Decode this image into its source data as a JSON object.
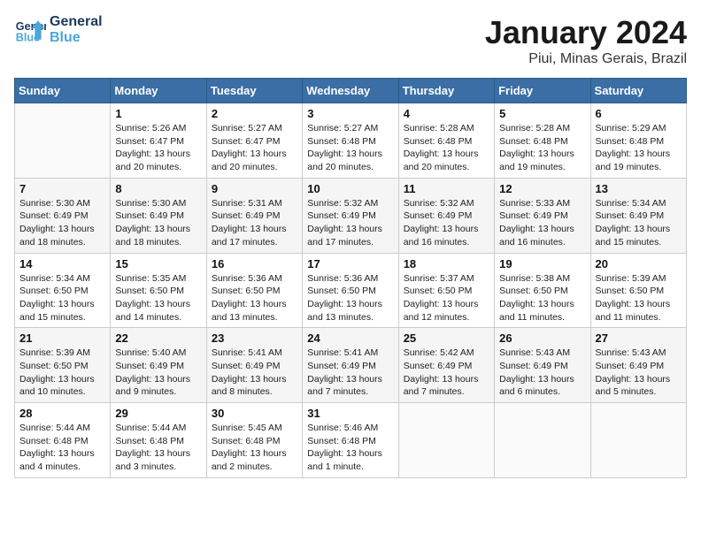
{
  "header": {
    "logo_line1": "General",
    "logo_line2": "Blue",
    "title": "January 2024",
    "subtitle": "Piui, Minas Gerais, Brazil"
  },
  "weekdays": [
    "Sunday",
    "Monday",
    "Tuesday",
    "Wednesday",
    "Thursday",
    "Friday",
    "Saturday"
  ],
  "weeks": [
    [
      {
        "day": "",
        "info": ""
      },
      {
        "day": "1",
        "info": "Sunrise: 5:26 AM\nSunset: 6:47 PM\nDaylight: 13 hours\nand 20 minutes."
      },
      {
        "day": "2",
        "info": "Sunrise: 5:27 AM\nSunset: 6:47 PM\nDaylight: 13 hours\nand 20 minutes."
      },
      {
        "day": "3",
        "info": "Sunrise: 5:27 AM\nSunset: 6:48 PM\nDaylight: 13 hours\nand 20 minutes."
      },
      {
        "day": "4",
        "info": "Sunrise: 5:28 AM\nSunset: 6:48 PM\nDaylight: 13 hours\nand 20 minutes."
      },
      {
        "day": "5",
        "info": "Sunrise: 5:28 AM\nSunset: 6:48 PM\nDaylight: 13 hours\nand 19 minutes."
      },
      {
        "day": "6",
        "info": "Sunrise: 5:29 AM\nSunset: 6:48 PM\nDaylight: 13 hours\nand 19 minutes."
      }
    ],
    [
      {
        "day": "7",
        "info": "Sunrise: 5:30 AM\nSunset: 6:49 PM\nDaylight: 13 hours\nand 18 minutes."
      },
      {
        "day": "8",
        "info": "Sunrise: 5:30 AM\nSunset: 6:49 PM\nDaylight: 13 hours\nand 18 minutes."
      },
      {
        "day": "9",
        "info": "Sunrise: 5:31 AM\nSunset: 6:49 PM\nDaylight: 13 hours\nand 17 minutes."
      },
      {
        "day": "10",
        "info": "Sunrise: 5:32 AM\nSunset: 6:49 PM\nDaylight: 13 hours\nand 17 minutes."
      },
      {
        "day": "11",
        "info": "Sunrise: 5:32 AM\nSunset: 6:49 PM\nDaylight: 13 hours\nand 16 minutes."
      },
      {
        "day": "12",
        "info": "Sunrise: 5:33 AM\nSunset: 6:49 PM\nDaylight: 13 hours\nand 16 minutes."
      },
      {
        "day": "13",
        "info": "Sunrise: 5:34 AM\nSunset: 6:49 PM\nDaylight: 13 hours\nand 15 minutes."
      }
    ],
    [
      {
        "day": "14",
        "info": "Sunrise: 5:34 AM\nSunset: 6:50 PM\nDaylight: 13 hours\nand 15 minutes."
      },
      {
        "day": "15",
        "info": "Sunrise: 5:35 AM\nSunset: 6:50 PM\nDaylight: 13 hours\nand 14 minutes."
      },
      {
        "day": "16",
        "info": "Sunrise: 5:36 AM\nSunset: 6:50 PM\nDaylight: 13 hours\nand 13 minutes."
      },
      {
        "day": "17",
        "info": "Sunrise: 5:36 AM\nSunset: 6:50 PM\nDaylight: 13 hours\nand 13 minutes."
      },
      {
        "day": "18",
        "info": "Sunrise: 5:37 AM\nSunset: 6:50 PM\nDaylight: 13 hours\nand 12 minutes."
      },
      {
        "day": "19",
        "info": "Sunrise: 5:38 AM\nSunset: 6:50 PM\nDaylight: 13 hours\nand 11 minutes."
      },
      {
        "day": "20",
        "info": "Sunrise: 5:39 AM\nSunset: 6:50 PM\nDaylight: 13 hours\nand 11 minutes."
      }
    ],
    [
      {
        "day": "21",
        "info": "Sunrise: 5:39 AM\nSunset: 6:50 PM\nDaylight: 13 hours\nand 10 minutes."
      },
      {
        "day": "22",
        "info": "Sunrise: 5:40 AM\nSunset: 6:49 PM\nDaylight: 13 hours\nand 9 minutes."
      },
      {
        "day": "23",
        "info": "Sunrise: 5:41 AM\nSunset: 6:49 PM\nDaylight: 13 hours\nand 8 minutes."
      },
      {
        "day": "24",
        "info": "Sunrise: 5:41 AM\nSunset: 6:49 PM\nDaylight: 13 hours\nand 7 minutes."
      },
      {
        "day": "25",
        "info": "Sunrise: 5:42 AM\nSunset: 6:49 PM\nDaylight: 13 hours\nand 7 minutes."
      },
      {
        "day": "26",
        "info": "Sunrise: 5:43 AM\nSunset: 6:49 PM\nDaylight: 13 hours\nand 6 minutes."
      },
      {
        "day": "27",
        "info": "Sunrise: 5:43 AM\nSunset: 6:49 PM\nDaylight: 13 hours\nand 5 minutes."
      }
    ],
    [
      {
        "day": "28",
        "info": "Sunrise: 5:44 AM\nSunset: 6:48 PM\nDaylight: 13 hours\nand 4 minutes."
      },
      {
        "day": "29",
        "info": "Sunrise: 5:44 AM\nSunset: 6:48 PM\nDaylight: 13 hours\nand 3 minutes."
      },
      {
        "day": "30",
        "info": "Sunrise: 5:45 AM\nSunset: 6:48 PM\nDaylight: 13 hours\nand 2 minutes."
      },
      {
        "day": "31",
        "info": "Sunrise: 5:46 AM\nSunset: 6:48 PM\nDaylight: 13 hours\nand 1 minute."
      },
      {
        "day": "",
        "info": ""
      },
      {
        "day": "",
        "info": ""
      },
      {
        "day": "",
        "info": ""
      }
    ]
  ]
}
